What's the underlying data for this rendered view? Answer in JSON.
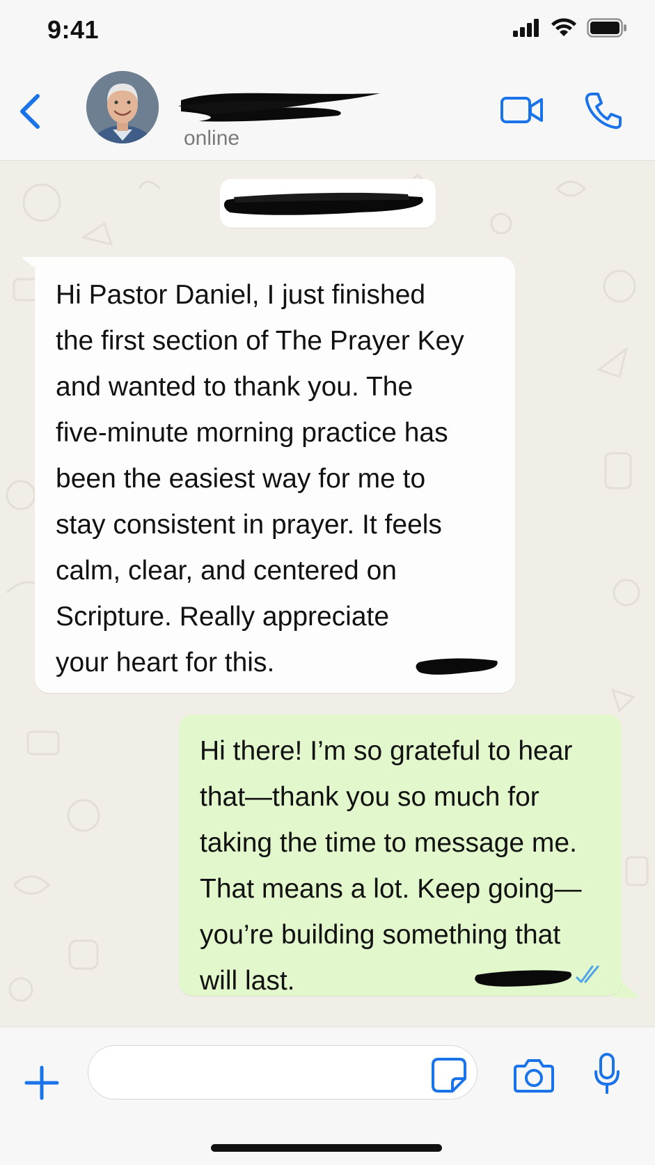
{
  "status_bar": {
    "time": "9:41",
    "icons": [
      "signal-icon",
      "wifi-icon",
      "battery-icon"
    ]
  },
  "header": {
    "back_icon": "chevron-left-icon",
    "contact_name": "",
    "contact_name_redacted": true,
    "status": "online",
    "video_icon": "video-icon",
    "call_icon": "phone-icon"
  },
  "chat": {
    "date_chip": "",
    "date_chip_redacted": true,
    "messages": [
      {
        "direction": "incoming",
        "lines": [
          "Hi Pastor Daniel, I just finished",
          "the first section of The Prayer Key",
          "and wanted to thank you. The",
          "five-minute morning practice has",
          "been the easiest way for me to",
          "stay consistent in prayer. It feels",
          "calm, clear, and centered on",
          "Scripture. Really appreciate",
          "your heart for this."
        ],
        "timestamp_redacted": true
      },
      {
        "direction": "outgoing",
        "lines": [
          "Hi there! I’m so grateful to hear",
          "that—thank you so much for",
          "taking the time to message me.",
          "That means a lot. Keep going—",
          "you’re building something that",
          "will last."
        ],
        "timestamp_redacted": true,
        "read_receipt_icon": "double-check-icon"
      }
    ]
  },
  "input_bar": {
    "plus_icon": "plus-icon",
    "message_value": "",
    "sticker_icon": "sticker-icon",
    "camera_icon": "camera-icon",
    "mic_icon": "microphone-icon"
  },
  "colors": {
    "accent": "#1a73e8",
    "outgoing_bubble": "#e2f8cc",
    "incoming_bubble": "#fdfdfd",
    "chat_background": "#f1eee7",
    "read_check": "#4fa3e8"
  }
}
